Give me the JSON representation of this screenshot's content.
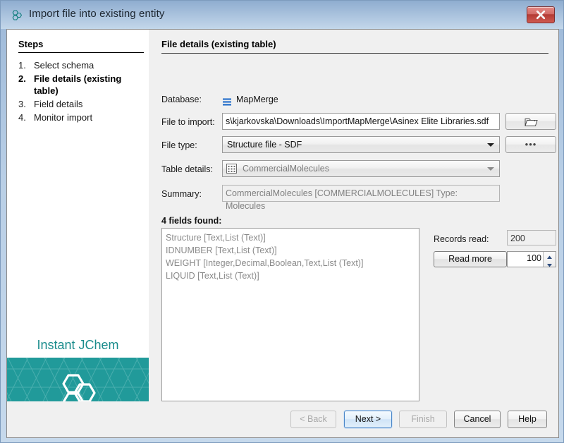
{
  "window": {
    "title": "Import file into existing entity",
    "title_icon": "hexagon-cluster-icon",
    "close_label": "✕"
  },
  "steps_panel": {
    "heading": "Steps",
    "items": [
      {
        "num": "1.",
        "label": "Select schema",
        "active": false
      },
      {
        "num": "2.",
        "label": "File details (existing table)",
        "active": true
      },
      {
        "num": "3.",
        "label": "Field details",
        "active": false
      },
      {
        "num": "4.",
        "label": "Monitor import",
        "active": false
      }
    ],
    "brand_name": "Instant JChem",
    "brand_color": "#219a9a"
  },
  "main": {
    "pane_title": "File details (existing table)",
    "database": {
      "label": "Database:",
      "icon": "database-lines-icon",
      "value": "MapMerge",
      "icon_color": "#1464c8"
    },
    "file_to_import": {
      "label": "File to import:",
      "value": "s\\kjarkovska\\Downloads\\ImportMapMerge\\Asinex Elite Libraries.sdf",
      "browse_icon": "folder-icon"
    },
    "file_type": {
      "label": "File type:",
      "value": "Structure file - SDF",
      "more_button_label": "•••"
    },
    "table_details": {
      "label": "Table details:",
      "icon": "grid-table-icon",
      "value": "CommercialMolecules",
      "disabled": true
    },
    "summary": {
      "label": "Summary:",
      "value": "CommercialMolecules [COMMERCIALMOLECULES] Type: Molecules",
      "disabled": true
    },
    "fields": {
      "caption": "4 fields found:",
      "items": [
        "Structure [Text,List (Text)]",
        "IDNUMBER [Text,List (Text)]",
        "WEIGHT [Integer,Decimal,Boolean,Text,List (Text)]",
        "LIQUID [Text,List (Text)]"
      ]
    },
    "records": {
      "label": "Records read:",
      "value": "200",
      "read_more_label": "Read more",
      "spinner_value": "100"
    }
  },
  "footer": {
    "buttons": [
      {
        "name": "back",
        "label": "< Back",
        "state": "disabled"
      },
      {
        "name": "next",
        "label": "Next >",
        "state": "default"
      },
      {
        "name": "finish",
        "label": "Finish",
        "state": "disabled"
      },
      {
        "name": "cancel",
        "label": "Cancel",
        "state": "normal"
      },
      {
        "name": "help",
        "label": "Help",
        "state": "normal"
      }
    ]
  }
}
